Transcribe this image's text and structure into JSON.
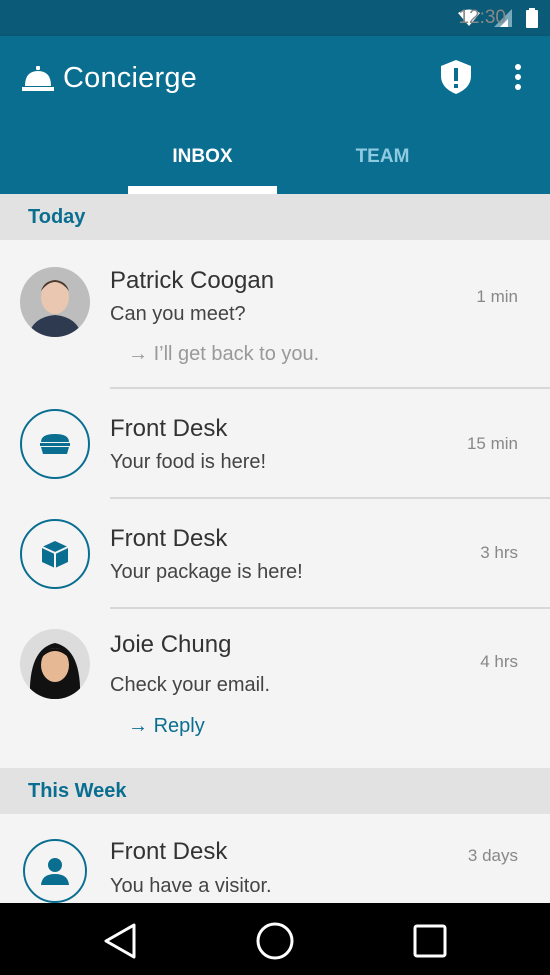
{
  "status_bar": {
    "time": "12:30"
  },
  "app": {
    "title": "Concierge",
    "icon": "bell-icon"
  },
  "tabs": [
    {
      "label": "INBOX",
      "active": true
    },
    {
      "label": "TEAM",
      "active": false
    }
  ],
  "sections": [
    {
      "label": "Today"
    },
    {
      "label": "This Week"
    }
  ],
  "messages": [
    {
      "sender": "Patrick Coogan",
      "preview": "Can you meet?",
      "time": "1 min",
      "reply": "I’ll get back to you."
    },
    {
      "sender": "Front Desk",
      "preview": "Your food is here!",
      "time": "15 min",
      "icon": "sandwich-icon"
    },
    {
      "sender": "Front Desk",
      "preview": "Your package is here!",
      "time": "3 hrs",
      "icon": "package-icon"
    },
    {
      "sender": "Joie Chung",
      "preview": "Check your email.",
      "time": "4 hrs",
      "reply": "Reply"
    },
    {
      "sender": "Front Desk",
      "preview": "You have a visitor.",
      "time": "3 days",
      "icon": "person-icon"
    }
  ],
  "colors": {
    "primary": "#0a6e90",
    "primary_dark": "#0a5a78",
    "section_bg": "#e2e2e2"
  }
}
